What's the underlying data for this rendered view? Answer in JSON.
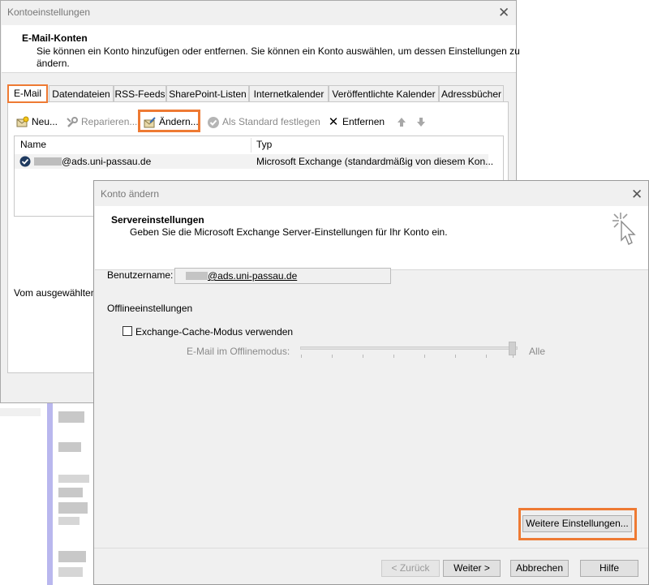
{
  "account_settings": {
    "window_title": "Kontoeinstellungen",
    "header_title": "E-Mail-Konten",
    "header_desc_line1": "Sie können ein Konto hinzufügen oder entfernen. Sie können ein Konto auswählen, um dessen Einstellungen zu",
    "header_desc_line2": "ändern.",
    "tabs": [
      {
        "label": "E-Mail"
      },
      {
        "label": "Datendateien"
      },
      {
        "label": "RSS-Feeds"
      },
      {
        "label": "SharePoint-Listen"
      },
      {
        "label": "Internetkalender"
      },
      {
        "label": "Veröffentlichte Kalender"
      },
      {
        "label": "Adressbücher"
      }
    ],
    "toolbar": {
      "new_label": "Neu...",
      "repair_label": "Reparieren...",
      "change_label": "Ändern...",
      "set_default_label": "Als Standard festlegen",
      "remove_label": "Entfernen"
    },
    "table": {
      "col_name": "Name",
      "col_type": "Typ",
      "rows": [
        {
          "name": "@ads.uni-passau.de",
          "type": "Microsoft Exchange (standardmäßig von diesem Kon..."
        }
      ]
    },
    "footer_partial": "Vom ausgewählten"
  },
  "change_account": {
    "window_title": "Konto ändern",
    "header_title": "Servereinstellungen",
    "header_desc": "Geben Sie die Microsoft Exchange Server-Einstellungen für Ihr Konto ein.",
    "username_label": "Benutzername:",
    "username_value": "@ads.uni-passau.de",
    "offline_section": "Offlineeinstellungen",
    "cache_mode_label": "Exchange-Cache-Modus verwenden",
    "cache_mode_checked": false,
    "offline_mail_label": "E-Mail im Offlinemodus:",
    "offline_mail_value": "Alle",
    "more_settings_label": "Weitere Einstellungen...",
    "buttons": {
      "back": "< Zurück",
      "next": "Weiter >",
      "cancel": "Abbrechen",
      "help": "Hilfe"
    }
  },
  "colors": {
    "highlight": "#ee7a33",
    "dialog_bg": "#f0f0f0"
  }
}
